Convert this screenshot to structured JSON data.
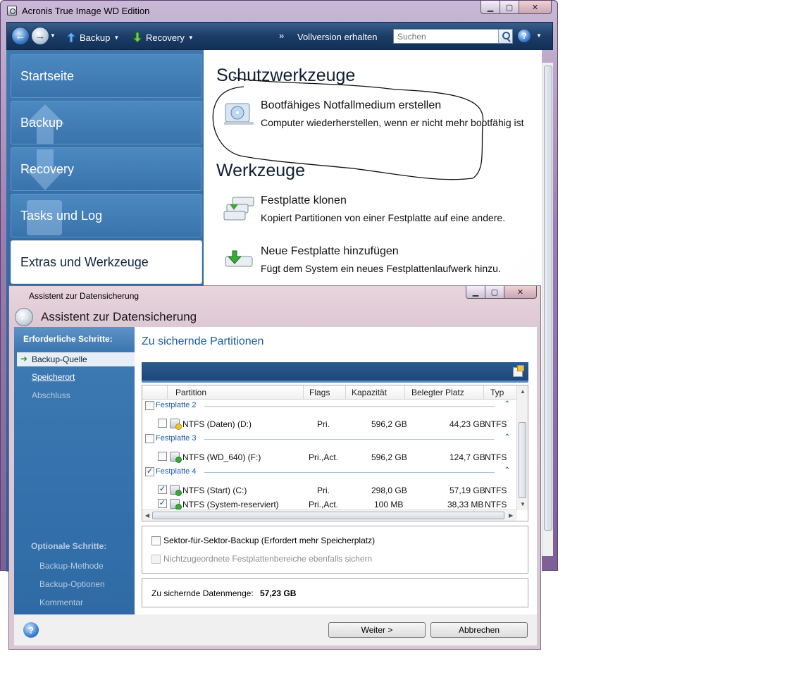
{
  "app": {
    "title": "Acronis True Image WD Edition",
    "toolbar": {
      "backup_label": "Backup",
      "recovery_label": "Recovery",
      "full_version_prefix": "»",
      "full_version_label": "Vollversion erhalten",
      "search_placeholder": "Suchen",
      "help_label": "?"
    },
    "nav": [
      {
        "label": "Startseite"
      },
      {
        "label": "Backup"
      },
      {
        "label": "Recovery"
      },
      {
        "label": "Tasks und Log"
      },
      {
        "label": "Extras und Werkzeuge",
        "active": true
      }
    ],
    "content": {
      "section1_title": "Schutzwerkzeuge",
      "tool1_name": "Bootfähiges Notfallmedium erstellen",
      "tool1_desc": "Computer wiederherstellen, wenn er nicht mehr bootfähig ist",
      "section2_title": "Werkzeuge",
      "tool2_name": "Festplatte klonen",
      "tool2_desc": "Kopiert Partitionen von einer Festplatte auf eine andere.",
      "tool3_name": "Neue Festplatte hinzufügen",
      "tool3_desc": "Fügt dem System ein neues Festplattenlaufwerk hinzu."
    }
  },
  "wizard": {
    "window_title": "Assistent zur Datensicherung",
    "header": "Assistent zur Datensicherung",
    "required_steps_label": "Erforderliche Schritte:",
    "steps": [
      {
        "label": "Backup-Quelle",
        "state": "current"
      },
      {
        "label": "Speicherort",
        "state": "link"
      },
      {
        "label": "Abschluss",
        "state": "dim"
      }
    ],
    "optional_steps_label": "Optionale Schritte:",
    "optional_steps": [
      {
        "label": "Backup-Methode"
      },
      {
        "label": "Backup-Optionen"
      },
      {
        "label": "Kommentar"
      }
    ],
    "main_title": "Zu sichernde Partitionen",
    "columns": [
      "Partition",
      "Flags",
      "Kapazität",
      "Belegter Platz",
      "Typ"
    ],
    "groups": [
      {
        "name": "Festplatte 2",
        "checked": false,
        "rows": [
          {
            "partition": "NTFS (Daten) (D:)",
            "flags": "Pri.",
            "capacity": "596,2 GB",
            "used": "44,23 GB",
            "type": "NTFS",
            "checked": false,
            "icon_color": "#f0c528"
          }
        ]
      },
      {
        "name": "Festplatte 3",
        "checked": false,
        "rows": [
          {
            "partition": "NTFS (WD_640) (F:)",
            "flags": "Pri.,Act.",
            "capacity": "596,2 GB",
            "used": "124,7 GB",
            "type": "NTFS",
            "checked": false,
            "icon_color": "#3aa93a"
          }
        ]
      },
      {
        "name": "Festplatte 4",
        "checked": true,
        "rows": [
          {
            "partition": "NTFS (Start) (C:)",
            "flags": "Pri.",
            "capacity": "298,0 GB",
            "used": "57,19 GB",
            "type": "NTFS",
            "checked": true,
            "icon_color": "#3aa93a"
          },
          {
            "partition": "NTFS (System-reserviert)",
            "flags": "Pri.,Act.",
            "capacity": "100 MB",
            "used": "38,33 MB",
            "type": "NTFS",
            "checked": true,
            "icon_color": "#3aa93a"
          }
        ]
      }
    ],
    "option_sector": "Sektor-für-Sektor-Backup (Erfordert mehr Speicherplatz)",
    "option_unallocated": "Nichtzugeordnete Festplattenbereiche ebenfalls sichern",
    "amount_label": "Zu sichernde Datenmenge:",
    "amount_value": "57,23 GB",
    "next_button": "Weiter >",
    "cancel_button": "Abbrechen",
    "help_label": "?"
  }
}
